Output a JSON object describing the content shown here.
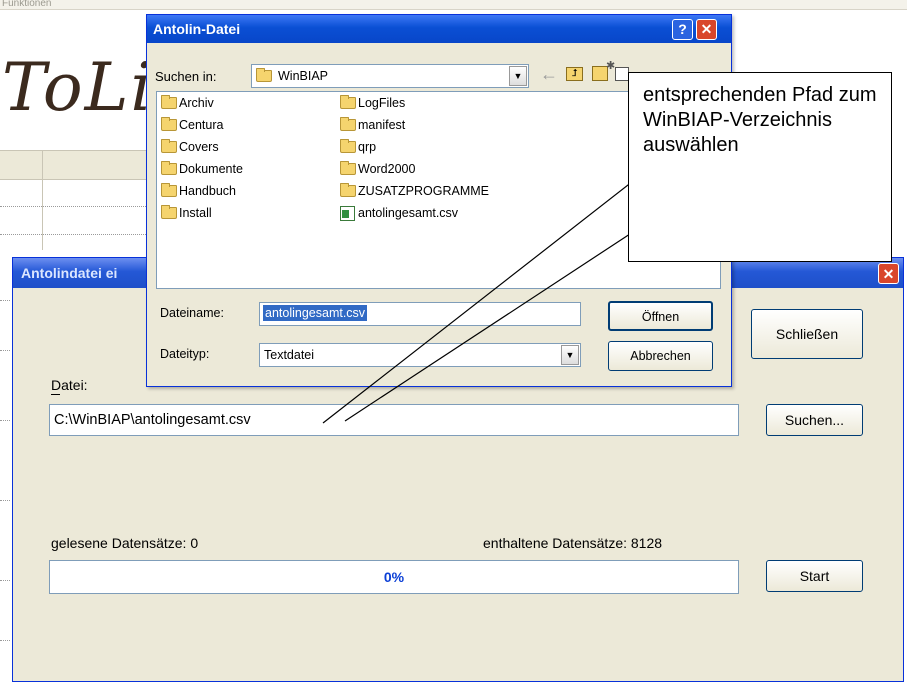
{
  "background": {
    "menu_text": "Funktionen",
    "logo_text": "ToLin"
  },
  "main_dialog": {
    "title": "Antolindatei ei",
    "close_glyph": "✕",
    "close_button": "Schließen",
    "file_label": "Datei:",
    "file_path": "C:\\WinBIAP\\antolingesamt.csv",
    "search_button": "Suchen...",
    "read_records_label": "gelesene Datensätze:",
    "read_records_value": "0",
    "contained_records_label": "enthaltene Datensätze:",
    "contained_records_value": "8128",
    "progress_text": "0%",
    "progress_fraction": 0,
    "start_button": "Start"
  },
  "file_dialog": {
    "title": "Antolin-Datei",
    "help_glyph": "?",
    "close_glyph": "✕",
    "look_in_label": "Suchen in:",
    "look_in_value": "WinBIAP",
    "toolbar_icons": [
      "back-arrow-icon",
      "up-folder-icon",
      "new-folder-icon",
      "view-menu-icon"
    ],
    "items": [
      {
        "name": "Archiv",
        "type": "folder"
      },
      {
        "name": "Centura",
        "type": "folder"
      },
      {
        "name": "Covers",
        "type": "folder"
      },
      {
        "name": "Dokumente",
        "type": "folder"
      },
      {
        "name": "Handbuch",
        "type": "folder"
      },
      {
        "name": "Install",
        "type": "folder"
      },
      {
        "name": "LogFiles",
        "type": "folder"
      },
      {
        "name": "manifest",
        "type": "folder"
      },
      {
        "name": "qrp",
        "type": "folder"
      },
      {
        "name": "Word2000",
        "type": "folder"
      },
      {
        "name": "ZUSATZPROGRAMME",
        "type": "folder"
      },
      {
        "name": "antolingesamt.csv",
        "type": "csv"
      }
    ],
    "filename_label": "Dateiname:",
    "filename_value": "antolingesamt.csv",
    "filetype_label": "Dateityp:",
    "filetype_value": "Textdatei",
    "open_button": "Öffnen",
    "cancel_button": "Abbrechen"
  },
  "callout": {
    "text": "entsprechenden Pfad zum WinBIAP-Verzeichnis auswählen"
  },
  "colors": {
    "titlebar": "#0a4fd4",
    "dialog_face": "#ece9d8",
    "progress_text": "#0b3fd6",
    "selection": "#316ac5"
  }
}
